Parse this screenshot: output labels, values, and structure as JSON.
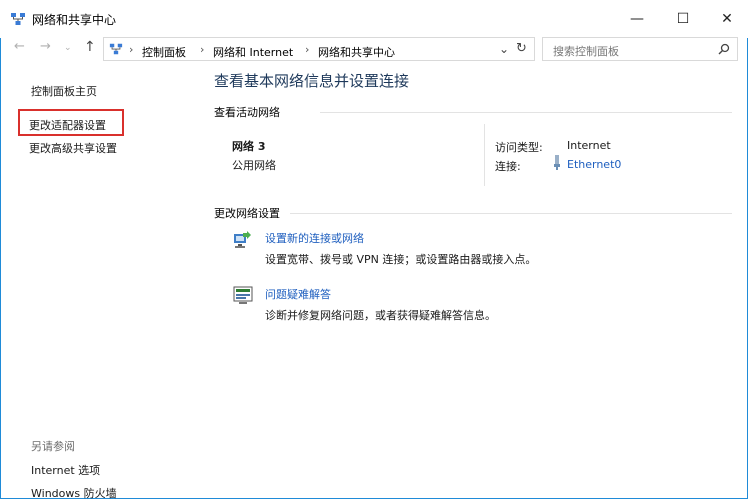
{
  "window": {
    "title": "网络和共享中心",
    "minimize": "—",
    "maximize": "☐",
    "close": "✕"
  },
  "address": {
    "crumbs": [
      "控制面板",
      "网络和 Internet",
      "网络和共享中心"
    ],
    "search_placeholder": "搜索控制面板"
  },
  "left": {
    "home": "控制面板主页",
    "adapter": "更改适配器设置",
    "advanced": "更改高级共享设置",
    "see_also": "另请参阅",
    "internet_options": "Internet 选项",
    "firewall": "Windows 防火墙"
  },
  "main": {
    "heading": "查看基本网络信息并设置连接",
    "active_section": "查看活动网络",
    "network_name": "网络 3",
    "network_type": "公用网络",
    "access_label": "访问类型:",
    "access_value": "Internet",
    "conn_label": "连接:",
    "conn_value": "Ethernet0",
    "change_section": "更改网络设置",
    "task1_title": "设置新的连接或网络",
    "task1_desc": "设置宽带、拨号或 VPN 连接；或设置路由器或接入点。",
    "task2_title": "问题疑难解答",
    "task2_desc": "诊断并修复网络问题，或者获得疑难解答信息。"
  }
}
